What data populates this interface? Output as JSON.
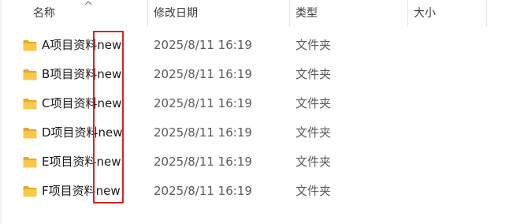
{
  "columns": {
    "name": "名称",
    "date_modified": "修改日期",
    "type": "类型",
    "size": "大小"
  },
  "sort": {
    "column": "name",
    "direction": "ascending"
  },
  "files": [
    {
      "name": "A项目资料new",
      "date": "2025/8/11 16:19",
      "type": "文件夹",
      "size": ""
    },
    {
      "name": "B项目资料new",
      "date": "2025/8/11 16:19",
      "type": "文件夹",
      "size": ""
    },
    {
      "name": "C项目资料new",
      "date": "2025/8/11 16:19",
      "type": "文件夹",
      "size": ""
    },
    {
      "name": "D项目资料new",
      "date": "2025/8/11 16:19",
      "type": "文件夹",
      "size": ""
    },
    {
      "name": "E项目资料new",
      "date": "2025/8/11 16:19",
      "type": "文件夹",
      "size": ""
    },
    {
      "name": "F项目资料new",
      "date": "2025/8/11 16:19",
      "type": "文件夹",
      "size": ""
    }
  ],
  "icons": {
    "folder": "folder-icon",
    "sort": "sort-up-icon"
  },
  "colors": {
    "folder": "#f8c84a",
    "highlight": "#e02020"
  }
}
